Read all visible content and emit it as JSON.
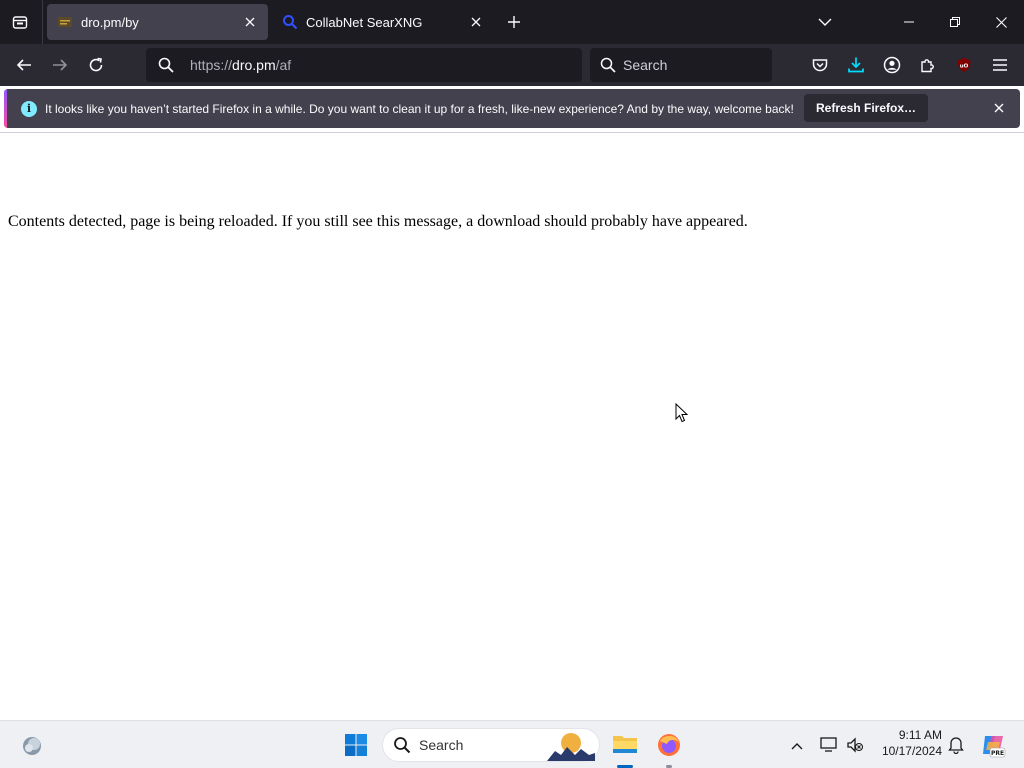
{
  "tabs": [
    {
      "title": "dro.pm/by",
      "active": true
    },
    {
      "title": "CollabNet SearXNG",
      "active": false
    }
  ],
  "navbar": {
    "url_prefix": "https://",
    "url_host": "dro.pm",
    "url_path": "/af",
    "search_placeholder": "Search"
  },
  "notification": {
    "message": "It looks like you haven’t started Firefox in a while. Do you want to clean it up for a fresh, like-new experience? And by the way, welcome back!",
    "button_label": "Refresh Firefox…"
  },
  "page": {
    "message": "Contents detected, page is being reloaded. If you still see this message, a download should probably have appeared."
  },
  "taskbar": {
    "search_placeholder": "Search",
    "time": "9:11 AM",
    "date": "10/17/2024",
    "copilot_badge": "PRE"
  },
  "colors": {
    "tabstrip_bg": "#1c1b22",
    "toolbar_bg": "#2b2a33",
    "active_tab_bg": "#42414d",
    "download_accent": "#00ddff",
    "ublock_red": "#800000",
    "windows_blue": "#0067c0"
  }
}
